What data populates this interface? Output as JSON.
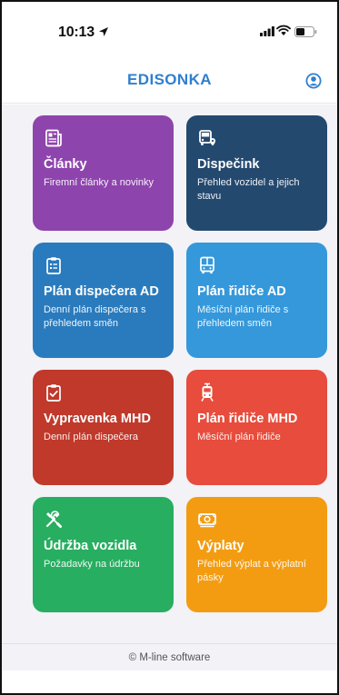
{
  "status_bar": {
    "time": "10:13",
    "icons": [
      "location-arrow-icon",
      "cellular-signal-icon",
      "wifi-icon",
      "battery-icon"
    ]
  },
  "header": {
    "title": "EDISONKA",
    "profile_icon": "user-circle-icon",
    "accent_color": "#2f7fcf"
  },
  "cards": [
    {
      "title": "Články",
      "description": "Firemní články a novinky",
      "icon": "newspaper-icon",
      "color": "#8e44ad"
    },
    {
      "title": "Dispečink",
      "description": "Přehled vozidel a jejich stavu",
      "icon": "bus-location-icon",
      "color": "#24496f"
    },
    {
      "title": "Plán dispečera AD",
      "description": "Denní plán dispečera s přehledem směn",
      "icon": "clipboard-list-icon",
      "color": "#2a7bbd"
    },
    {
      "title": "Plán řidiče AD",
      "description": "Měsíční plán řidiče s přehledem směn",
      "icon": "bus-icon",
      "color": "#3498db"
    },
    {
      "title": "Vypravenka MHD",
      "description": "Denní plán dispečera",
      "icon": "clipboard-check-icon",
      "color": "#c0392b"
    },
    {
      "title": "Plán řidiče MHD",
      "description": "Měsíční plán řidiče",
      "icon": "tram-icon",
      "color": "#e74c3c"
    },
    {
      "title": "Údržba vozidla",
      "description": "Požadavky na údržbu",
      "icon": "tools-icon",
      "color": "#27ae60"
    },
    {
      "title": "Výplaty",
      "description": "Přehled výplat a výplatní pásky",
      "icon": "money-icon",
      "color": "#f39c12"
    }
  ],
  "footer": {
    "text": "© M-line software"
  }
}
